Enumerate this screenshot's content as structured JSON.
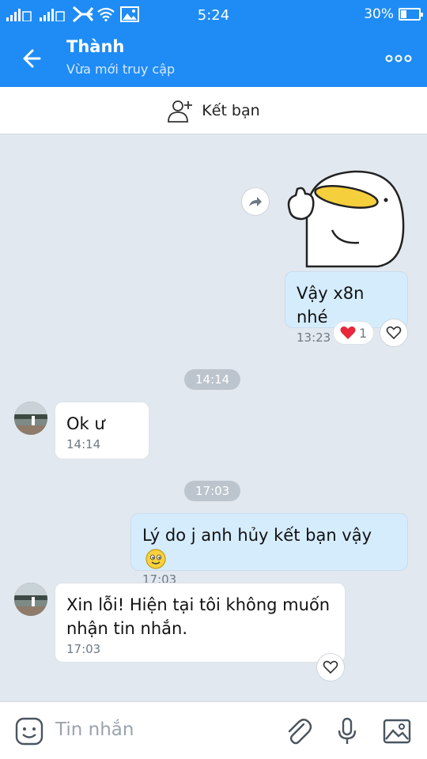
{
  "status_bar": {
    "time": "5:24",
    "battery": "30%",
    "battery_level": 0.3
  },
  "header": {
    "title": "Thành",
    "subtitle": "Vừa mới truy cập"
  },
  "friend_bar": {
    "label": "Kết bạn"
  },
  "messages": [
    {
      "sender": "me",
      "type": "sticker",
      "sticker": "duck-thumbs-up-sticker"
    },
    {
      "sender": "me",
      "text": "Vậy x8n nhé",
      "time": "13:23",
      "reaction": {
        "icon": "heart",
        "count": "1"
      }
    },
    {
      "type": "divider",
      "time": "14:14"
    },
    {
      "sender": "them",
      "text": "Ok ư",
      "time": "14:14"
    },
    {
      "type": "divider",
      "time": "17:03"
    },
    {
      "sender": "me",
      "text": "Lý do j anh hủy kết bạn vậy",
      "emoji": "smile-emoji",
      "time": "17:03"
    },
    {
      "sender": "them",
      "text_line1": "Xin lỗi! Hiện tại tôi không muốn",
      "text_line2": "nhận tin nhắn.",
      "time": "17:03"
    }
  ],
  "input": {
    "placeholder": "Tin nhắn"
  },
  "colors": {
    "accent": "#1f8cf5",
    "my_bubble": "#d5ecfc",
    "chat_bg": "#e2e8ef"
  }
}
